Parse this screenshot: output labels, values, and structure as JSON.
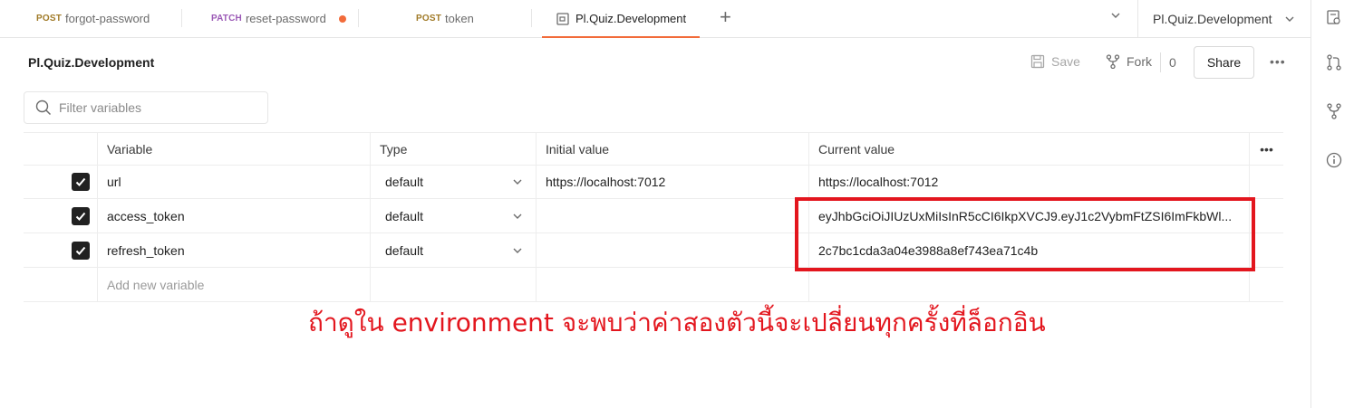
{
  "tabs": [
    {
      "method": "POST",
      "label": "forgot-password"
    },
    {
      "method": "PATCH",
      "label": "reset-password"
    },
    {
      "method": "POST",
      "label": "token"
    },
    {
      "label": "Pl.Quiz.Development"
    }
  ],
  "environment_selector": {
    "value": "Pl.Quiz.Development"
  },
  "header": {
    "title": "Pl.Quiz.Development",
    "save_label": "Save",
    "fork_label": "Fork",
    "fork_count": "0",
    "share_label": "Share",
    "more_label": "•••"
  },
  "filter": {
    "placeholder": "Filter variables"
  },
  "table": {
    "columns": [
      "Variable",
      "Type",
      "Initial value",
      "Current value"
    ],
    "more_label": "•••",
    "rows": [
      {
        "variable": "url",
        "type": "default",
        "initial": "https://localhost:7012",
        "current": "https://localhost:7012"
      },
      {
        "variable": "access_token",
        "type": "default",
        "initial": "",
        "current": "eyJhbGciOiJIUzUxMiIsInR5cCI6IkpXVCJ9.eyJ1c2VybmFtZSI6ImFkbWl..."
      },
      {
        "variable": "refresh_token",
        "type": "default",
        "initial": "",
        "current": "2c7bc1cda3a04e3988a8ef743ea71c4b"
      }
    ],
    "add_placeholder": "Add new variable"
  },
  "annotation": "ถ้าดูใน environment จะพบว่าค่าสองตัวนี้จะเปลี่ยนทุกครั้งที่ล็อกอิน",
  "colors": {
    "accent": "#f26b3a",
    "annotation": "#e3161e"
  }
}
